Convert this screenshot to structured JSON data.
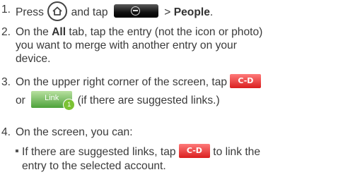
{
  "steps": {
    "s1": {
      "num": "1.",
      "pre": "Press",
      "mid": "and tap",
      "post": "> ",
      "bold": "People",
      "end": "."
    },
    "s2": {
      "num": "2.",
      "pre": "On the ",
      "bold": "All",
      "line1": " tab, tap the entry (not the icon or photo)",
      "line2": "you want to merge with another entry on your",
      "line3": "device."
    },
    "s3": {
      "num": "3.",
      "line1": "On the upper right corner of the screen, tap",
      "or": "or",
      "line2": "(if there are suggested links.)"
    },
    "s4": {
      "num": "4.",
      "line1": "On the screen, you can:"
    },
    "bullet1": {
      "pre": "If there are suggested links, tap",
      "post": "to link the",
      "line2": "entry to the selected account."
    }
  },
  "icons": {
    "home": "home-icon",
    "all_apps": "all-apps-icon",
    "link_red": "link-icon",
    "link_green": "link-suggested-icon"
  },
  "link_green_label": "Link",
  "link_green_badge": "1",
  "link_red_label": "C-D",
  "colors": {
    "link_red": "#d91f1f",
    "link_green": "#4da23a",
    "text": "#3a3a3a"
  }
}
